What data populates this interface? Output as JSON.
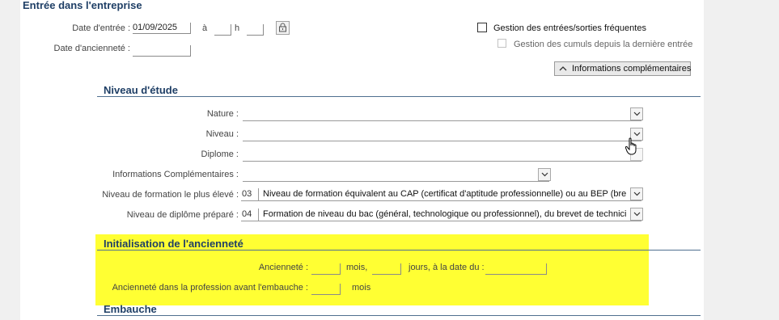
{
  "entree": {
    "title": "Entrée dans l'entreprise",
    "date_entree_label": "Date d'entrée :",
    "date_entree_value": "01/09/2025",
    "a_label": "à",
    "h_label": "h",
    "anciennete_label": "Date d'ancienneté :",
    "gestion_frequentes_label": "Gestion des entrées/sorties fréquentes",
    "gestion_cumuls_label": "Gestion des cumuls depuis la dernière entrée",
    "info_comp_button": "Informations complémentaires"
  },
  "niveau": {
    "title": "Niveau d'étude",
    "nature_label": "Nature :",
    "niveau_label": "Niveau :",
    "diplome_label": "Diplome :",
    "info_comp_label": "Informations Complémentaires :",
    "formation_label": "Niveau de formation le plus élevé :",
    "formation_code": "03",
    "formation_text": "Niveau de formation équivalent au CAP (certificat d'aptitude professionnelle) ou au BEP (brevet",
    "diplome_prepare_label": "Niveau de diplôme préparé :",
    "diplome_prepare_code": "04",
    "diplome_prepare_text": "Formation de niveau du bac (général, technologique ou professionnel), du brevet de technicien"
  },
  "init": {
    "title": "Initialisation de l'ancienneté",
    "anciennete_label": "Ancienneté :",
    "mois_label": "mois,",
    "jours_label": "jours, à la date du :",
    "profession_label": "Ancienneté dans la profession avant l'embauche :",
    "mois2_label": "mois"
  },
  "embauche": {
    "title": "Embauche"
  },
  "colors": {
    "highlight": "#ffff33",
    "section_title": "#1f3f66"
  }
}
